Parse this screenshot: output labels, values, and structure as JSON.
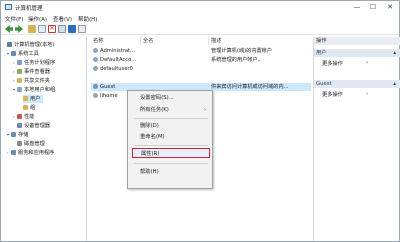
{
  "window": {
    "title": "计算机管理",
    "controls": {
      "minimize": "—",
      "maximize": "☐",
      "close": "✕"
    }
  },
  "menubar": [
    "文件(F)",
    "操作(A)",
    "查看(V)",
    "帮助(H)"
  ],
  "tree": [
    {
      "label": "计算机管理(本地)",
      "level": 0,
      "arrow": "",
      "icon_color": "#5a7ea6"
    },
    {
      "label": "系统工具",
      "level": 1,
      "arrow": "▾",
      "icon_color": "#6c8db0"
    },
    {
      "label": "任务计划程序",
      "level": 2,
      "arrow": "›",
      "icon_color": "#7a9cc0"
    },
    {
      "label": "事件查看器",
      "level": 2,
      "arrow": "›",
      "icon_color": "#8aa66b"
    },
    {
      "label": "共享文件夹",
      "level": 2,
      "arrow": "›",
      "icon_color": "#d8b25a"
    },
    {
      "label": "本地用户和组",
      "level": 2,
      "arrow": "▾",
      "icon_color": "#8aa6c4"
    },
    {
      "label": "用户",
      "level": 3,
      "arrow": "",
      "icon_color": "#d8b25a",
      "selected": true
    },
    {
      "label": "组",
      "level": 3,
      "arrow": "",
      "icon_color": "#d8b25a"
    },
    {
      "label": "性能",
      "level": 2,
      "arrow": "›",
      "icon_color": "#c55"
    },
    {
      "label": "设备管理器",
      "level": 2,
      "arrow": "",
      "icon_color": "#6c8db0"
    },
    {
      "label": "存储",
      "level": 1,
      "arrow": "▾",
      "icon_color": "#6c8db0"
    },
    {
      "label": "磁盘管理",
      "level": 2,
      "arrow": "",
      "icon_color": "#8a8a8a"
    },
    {
      "label": "服务和应用程序",
      "level": 1,
      "arrow": "›",
      "icon_color": "#6c8db0"
    }
  ],
  "list": {
    "columns": [
      "名称",
      "全名",
      "描述"
    ],
    "rows": [
      {
        "name": "Administrat...",
        "fullname": "",
        "desc": "管理计算机(域)的内置帐户"
      },
      {
        "name": "DefaultAcco...",
        "fullname": "",
        "desc": "系统管理的用户帐户。"
      },
      {
        "name": "defaultuser0",
        "fullname": "",
        "desc": ""
      },
      {
        "name": "Guest",
        "fullname": "",
        "desc": "供来宾访问计算机或访问域的内...",
        "selected": true
      },
      {
        "name": "lihome",
        "fullname": "",
        "desc": ""
      }
    ]
  },
  "actions": {
    "header": "操作",
    "groups": [
      {
        "title": "用户",
        "items": [
          "更多操作"
        ]
      },
      {
        "title": "Guest",
        "items": [
          "更多操作"
        ]
      }
    ]
  },
  "context_menu": {
    "items": [
      {
        "label": "设置密码(S)...",
        "submenu": false
      },
      {
        "label": "所有任务(K)",
        "submenu": true
      },
      {
        "sep": true
      },
      {
        "label": "删除(D)",
        "submenu": false
      },
      {
        "label": "重命名(M)",
        "submenu": false
      },
      {
        "sep": true
      },
      {
        "label": "属性(R)",
        "submenu": false,
        "highlight": true
      },
      {
        "sep": true
      },
      {
        "label": "帮助(H)",
        "submenu": false
      }
    ]
  },
  "colors": {
    "selection": "#cce8ff",
    "highlight_border": "#c3243a",
    "action_header_bg": "#dfe7f1"
  }
}
